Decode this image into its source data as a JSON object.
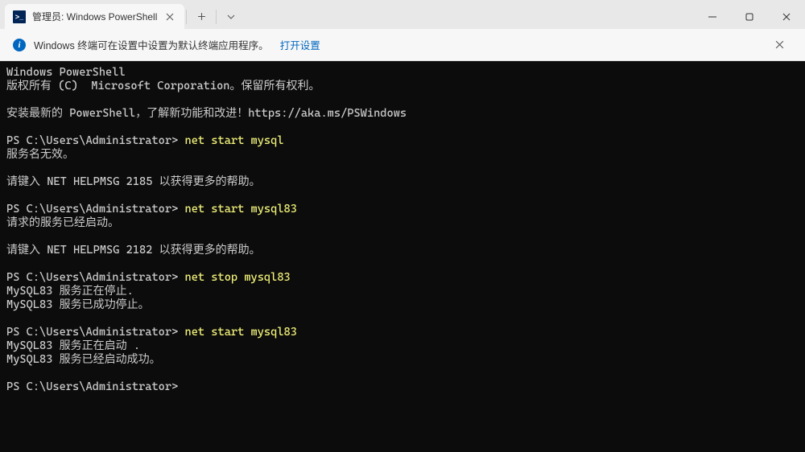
{
  "tab": {
    "icon_text": ">_",
    "title": "管理员: Windows PowerShell"
  },
  "infobar": {
    "text": "Windows 终端可在设置中设置为默认终端应用程序。",
    "link": "打开设置"
  },
  "terminal": {
    "line1": "Windows PowerShell",
    "line2": "版权所有 (C)  Microsoft Corporation。保留所有权利。",
    "line3": "安装最新的 PowerShell，了解新功能和改进！https://aka.ms/PSWindows",
    "prompt": "PS C:\\Users\\Administrator>",
    "cmd1": "net start mysql",
    "out1a": "服务名无效。",
    "out1b": "请键入 NET HELPMSG 2185 以获得更多的帮助。",
    "cmd2": "net start mysql83",
    "out2a": "请求的服务已经启动。",
    "out2b": "请键入 NET HELPMSG 2182 以获得更多的帮助。",
    "cmd3": "net stop mysql83",
    "out3a": "MySQL83 服务正在停止.",
    "out3b": "MySQL83 服务已成功停止。",
    "cmd4": "net start mysql83",
    "out4a": "MySQL83 服务正在启动 .",
    "out4b": "MySQL83 服务已经启动成功。"
  }
}
